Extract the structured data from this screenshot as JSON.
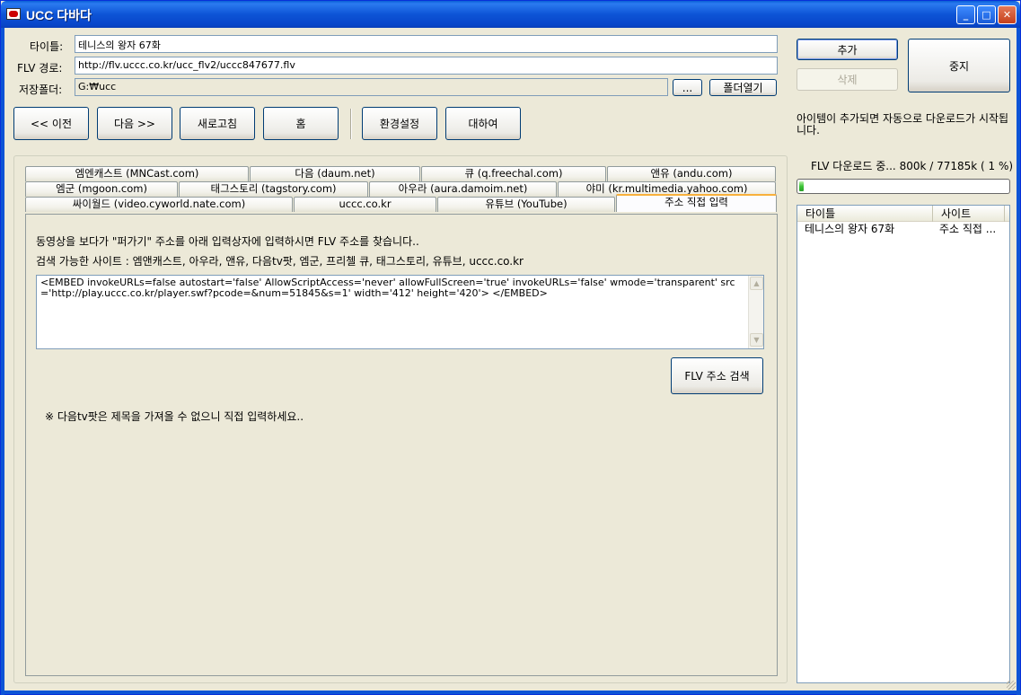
{
  "window": {
    "title": "UCC 다바다",
    "controls": {
      "minimize": "_",
      "maximize": "□",
      "close": "✕"
    }
  },
  "form": {
    "title_label": "타이틀:",
    "title_value": "테니스의 왕자 67화",
    "flv_label": "FLV 경로:",
    "flv_value": "http://flv.uccc.co.kr/ucc_flv2/uccc847677.flv",
    "folder_label": "저장폴더:",
    "folder_value": "G:₩ucc",
    "browse_label": "...",
    "open_folder_label": "폴더열기"
  },
  "actions": {
    "add_label": "추가",
    "delete_label": "삭제",
    "stop_label": "중지"
  },
  "nav": {
    "prev_label": "<< 이전",
    "next_label": "다음 >>",
    "refresh_label": "새로고침",
    "home_label": "홈",
    "settings_label": "환경설정",
    "about_label": "대하여"
  },
  "notice": "아이템이 추가되면 자동으로 다운로드가 시작됩니다.",
  "tabs": {
    "row1": [
      "엠엔캐스트 (MNCast.com)",
      "다음 (daum.net)",
      "큐 (q.freechal.com)",
      "앤유 (andu.com)"
    ],
    "row2": [
      "엠군 (mgoon.com)",
      "태그스토리 (tagstory.com)",
      "아우라 (aura.damoim.net)",
      "야미 (kr.multimedia.yahoo.com)"
    ],
    "row3": [
      "싸이월드 (video.cyworld.nate.com)",
      "uccc.co.kr",
      "유튜브 (YouTube)",
      "주소 직접 입력"
    ]
  },
  "panel": {
    "instruction": "동영상을 보다가 \"퍼가기\" 주소를 아래 입력상자에 입력하시면 FLV 주소를 찾습니다..",
    "sites": "검색 가능한 사이트 : 엠앤캐스트, 아우라, 앤유, 다음tv팟, 엠군, 프리첼 큐, 태그스토리, 유튜브, uccc.co.kr",
    "embed_code": "<EMBED invokeURLs=false autostart='false' AllowScriptAccess='never' allowFullScreen='true' invokeURLs='false' wmode='transparent' src='http://play.uccc.co.kr/player.swf?pcode=&num=51845&s=1' width='412' height='420'> </EMBED>",
    "search_button": "FLV 주소 검색",
    "footnote": "※ 다음tv팟은 제목을 가져올 수 없으니 직접 입력하세요.."
  },
  "download": {
    "status": "FLV 다운로드 중... 800k / 77185k ( 1 %)",
    "progress_percent": 1,
    "progress_color": "#3bc436"
  },
  "list": {
    "columns": [
      "타이틀",
      "사이트"
    ],
    "rows": [
      {
        "title": "테니스의 왕자 67화",
        "site": "주소 직접 ..."
      }
    ]
  }
}
